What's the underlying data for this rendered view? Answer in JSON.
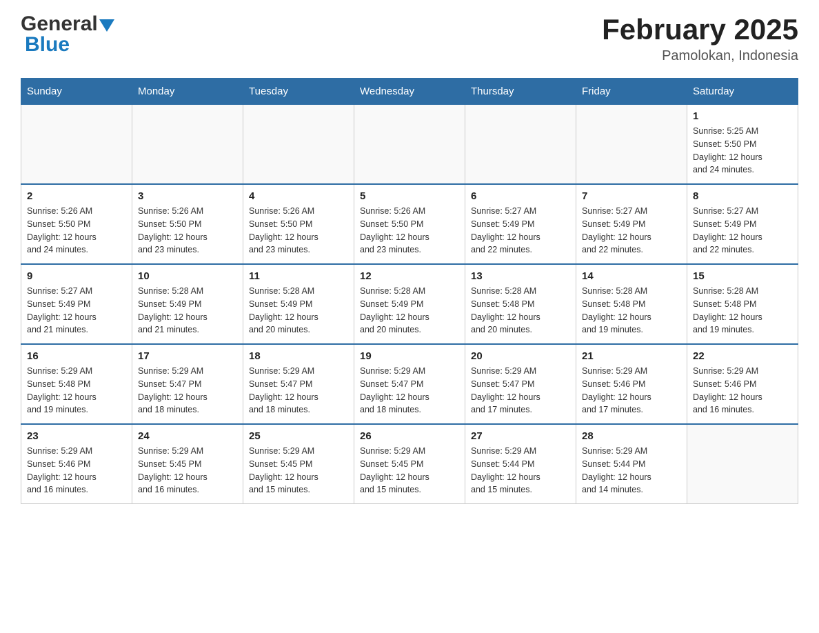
{
  "header": {
    "logo": {
      "general": "General",
      "blue": "Blue",
      "alt": "GeneralBlue logo"
    },
    "title": "February 2025",
    "subtitle": "Pamolokan, Indonesia"
  },
  "weekdays": [
    "Sunday",
    "Monday",
    "Tuesday",
    "Wednesday",
    "Thursday",
    "Friday",
    "Saturday"
  ],
  "weeks": [
    [
      {
        "day": "",
        "info": ""
      },
      {
        "day": "",
        "info": ""
      },
      {
        "day": "",
        "info": ""
      },
      {
        "day": "",
        "info": ""
      },
      {
        "day": "",
        "info": ""
      },
      {
        "day": "",
        "info": ""
      },
      {
        "day": "1",
        "info": "Sunrise: 5:25 AM\nSunset: 5:50 PM\nDaylight: 12 hours\nand 24 minutes."
      }
    ],
    [
      {
        "day": "2",
        "info": "Sunrise: 5:26 AM\nSunset: 5:50 PM\nDaylight: 12 hours\nand 24 minutes."
      },
      {
        "day": "3",
        "info": "Sunrise: 5:26 AM\nSunset: 5:50 PM\nDaylight: 12 hours\nand 23 minutes."
      },
      {
        "day": "4",
        "info": "Sunrise: 5:26 AM\nSunset: 5:50 PM\nDaylight: 12 hours\nand 23 minutes."
      },
      {
        "day": "5",
        "info": "Sunrise: 5:26 AM\nSunset: 5:50 PM\nDaylight: 12 hours\nand 23 minutes."
      },
      {
        "day": "6",
        "info": "Sunrise: 5:27 AM\nSunset: 5:49 PM\nDaylight: 12 hours\nand 22 minutes."
      },
      {
        "day": "7",
        "info": "Sunrise: 5:27 AM\nSunset: 5:49 PM\nDaylight: 12 hours\nand 22 minutes."
      },
      {
        "day": "8",
        "info": "Sunrise: 5:27 AM\nSunset: 5:49 PM\nDaylight: 12 hours\nand 22 minutes."
      }
    ],
    [
      {
        "day": "9",
        "info": "Sunrise: 5:27 AM\nSunset: 5:49 PM\nDaylight: 12 hours\nand 21 minutes."
      },
      {
        "day": "10",
        "info": "Sunrise: 5:28 AM\nSunset: 5:49 PM\nDaylight: 12 hours\nand 21 minutes."
      },
      {
        "day": "11",
        "info": "Sunrise: 5:28 AM\nSunset: 5:49 PM\nDaylight: 12 hours\nand 20 minutes."
      },
      {
        "day": "12",
        "info": "Sunrise: 5:28 AM\nSunset: 5:49 PM\nDaylight: 12 hours\nand 20 minutes."
      },
      {
        "day": "13",
        "info": "Sunrise: 5:28 AM\nSunset: 5:48 PM\nDaylight: 12 hours\nand 20 minutes."
      },
      {
        "day": "14",
        "info": "Sunrise: 5:28 AM\nSunset: 5:48 PM\nDaylight: 12 hours\nand 19 minutes."
      },
      {
        "day": "15",
        "info": "Sunrise: 5:28 AM\nSunset: 5:48 PM\nDaylight: 12 hours\nand 19 minutes."
      }
    ],
    [
      {
        "day": "16",
        "info": "Sunrise: 5:29 AM\nSunset: 5:48 PM\nDaylight: 12 hours\nand 19 minutes."
      },
      {
        "day": "17",
        "info": "Sunrise: 5:29 AM\nSunset: 5:47 PM\nDaylight: 12 hours\nand 18 minutes."
      },
      {
        "day": "18",
        "info": "Sunrise: 5:29 AM\nSunset: 5:47 PM\nDaylight: 12 hours\nand 18 minutes."
      },
      {
        "day": "19",
        "info": "Sunrise: 5:29 AM\nSunset: 5:47 PM\nDaylight: 12 hours\nand 18 minutes."
      },
      {
        "day": "20",
        "info": "Sunrise: 5:29 AM\nSunset: 5:47 PM\nDaylight: 12 hours\nand 17 minutes."
      },
      {
        "day": "21",
        "info": "Sunrise: 5:29 AM\nSunset: 5:46 PM\nDaylight: 12 hours\nand 17 minutes."
      },
      {
        "day": "22",
        "info": "Sunrise: 5:29 AM\nSunset: 5:46 PM\nDaylight: 12 hours\nand 16 minutes."
      }
    ],
    [
      {
        "day": "23",
        "info": "Sunrise: 5:29 AM\nSunset: 5:46 PM\nDaylight: 12 hours\nand 16 minutes."
      },
      {
        "day": "24",
        "info": "Sunrise: 5:29 AM\nSunset: 5:45 PM\nDaylight: 12 hours\nand 16 minutes."
      },
      {
        "day": "25",
        "info": "Sunrise: 5:29 AM\nSunset: 5:45 PM\nDaylight: 12 hours\nand 15 minutes."
      },
      {
        "day": "26",
        "info": "Sunrise: 5:29 AM\nSunset: 5:45 PM\nDaylight: 12 hours\nand 15 minutes."
      },
      {
        "day": "27",
        "info": "Sunrise: 5:29 AM\nSunset: 5:44 PM\nDaylight: 12 hours\nand 15 minutes."
      },
      {
        "day": "28",
        "info": "Sunrise: 5:29 AM\nSunset: 5:44 PM\nDaylight: 12 hours\nand 14 minutes."
      },
      {
        "day": "",
        "info": ""
      }
    ]
  ]
}
